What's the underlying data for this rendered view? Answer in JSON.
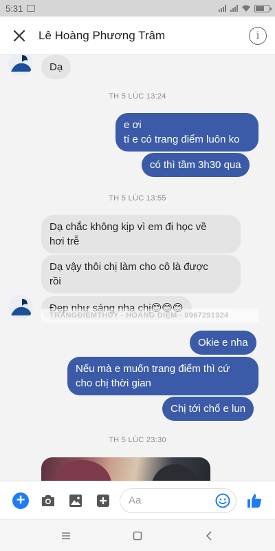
{
  "status_bar": {
    "time": "5:31"
  },
  "header": {
    "title": "Lê Hoàng Phương Trâm"
  },
  "colors": {
    "outgoing_bubble": "#3b5ba8",
    "incoming_bubble": "#e4e4e4",
    "accent": "#1f7cf2"
  },
  "messages": [
    {
      "direction": "incoming",
      "text": "Dạ"
    },
    {
      "timestamp": "TH 5 LÚC 13:24"
    },
    {
      "direction": "outgoing",
      "text": [
        "e ơi",
        "tí e có trang điểm luôn ko"
      ]
    },
    {
      "direction": "outgoing",
      "text": "có thì tầm 3h30 qua"
    },
    {
      "timestamp": "TH 5 LÚC 13:55"
    },
    {
      "direction": "incoming",
      "text": [
        "Dạ chắc không kịp vì em đi học về",
        "hơi trễ"
      ]
    },
    {
      "direction": "incoming",
      "text": [
        "Dạ vậy thôi chị làm cho cô là được",
        "rồi"
      ]
    },
    {
      "direction": "incoming",
      "text": "Đẹp như sáng nha chị😊😊😊"
    },
    {
      "direction": "outgoing",
      "text": "Okie e nha"
    },
    {
      "direction": "outgoing",
      "text": [
        "Nếu mà e muốn trang điểm thì cứ",
        "cho chị thời gian"
      ]
    },
    {
      "direction": "outgoing",
      "text": "Chị tới chổ e lun"
    },
    {
      "timestamp": "TH 5 LÚC 23:30"
    }
  ],
  "watermark": "TRANGĐIỂMTHUÝ - HOANG DIỆM - 0967291924",
  "composer": {
    "placeholder": "Aa"
  }
}
